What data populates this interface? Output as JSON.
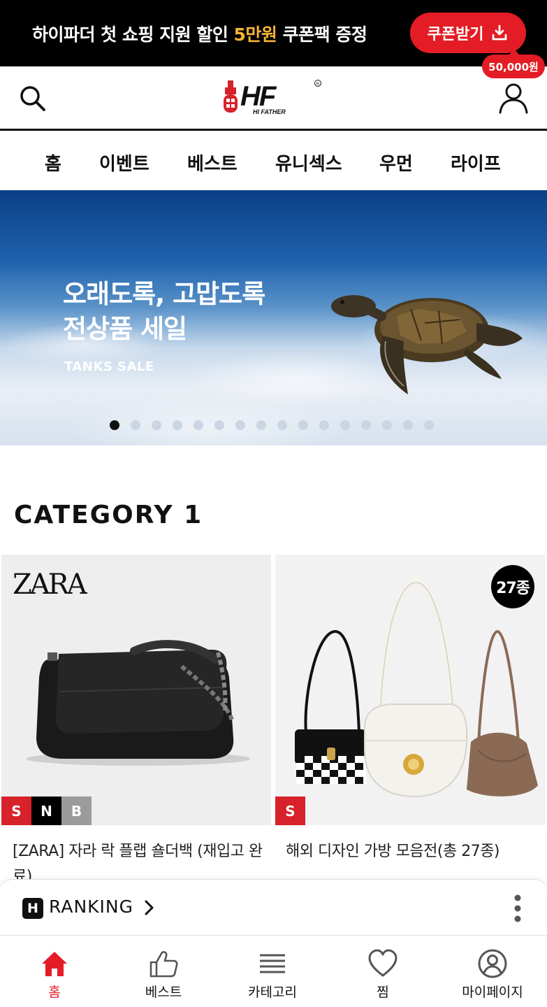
{
  "promo": {
    "text_before": "하이파더 첫 쇼핑 지원 할인 ",
    "text_highlight": "5만원",
    "text_after": " 쿠폰팩 증정",
    "button_label": "쿠폰받기"
  },
  "header": {
    "logo_text": "HF",
    "logo_subtext": "HI FATHER",
    "points": "50,000원"
  },
  "nav": {
    "items": [
      "홈",
      "이벤트",
      "베스트",
      "유니섹스",
      "우먼",
      "라이프"
    ]
  },
  "banner": {
    "title": "오래도록, 고맙도록\n전상품 세일",
    "subtitle": "TANKS SALE",
    "slide_count": 16,
    "active_slide": 1
  },
  "category": {
    "title": "CATEGORY 1",
    "products": [
      {
        "brand_logo": "ZARA",
        "name": "[ZARA] 자라 락 플랩 숄더백 (재입고 완료)",
        "tags": [
          "S",
          "N",
          "B"
        ],
        "count_badge": ""
      },
      {
        "brand_logo": "",
        "name": "해외 디자인 가방 모음전(총 27종)",
        "tags": [
          "S"
        ],
        "count_badge": "27종"
      }
    ]
  },
  "ranking": {
    "badge": "H",
    "label": "RANKING"
  },
  "tabbar": {
    "items": [
      {
        "label": "홈",
        "icon": "home-icon",
        "active": true
      },
      {
        "label": "베스트",
        "icon": "thumbs-up-icon",
        "active": false
      },
      {
        "label": "카테고리",
        "icon": "menu-icon",
        "active": false
      },
      {
        "label": "찜",
        "icon": "heart-icon",
        "active": false
      },
      {
        "label": "마이페이지",
        "icon": "user-circle-icon",
        "active": false
      }
    ]
  },
  "colors": {
    "brand_red": "#e31c25",
    "promo_highlight": "#f5b335",
    "promo_bg": "#000000"
  }
}
